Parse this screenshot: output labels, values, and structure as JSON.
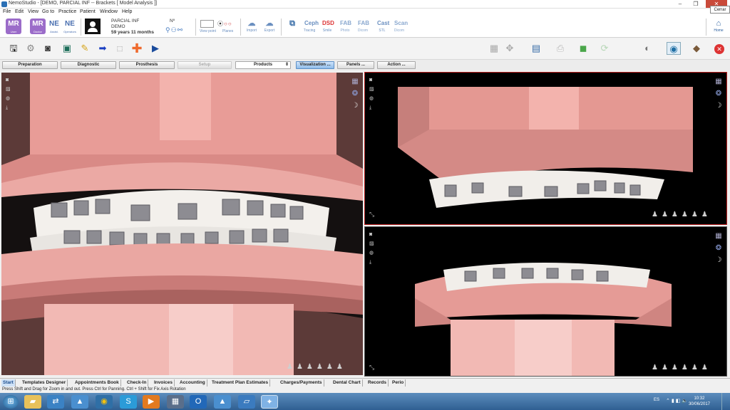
{
  "window": {
    "title": "NemoStudio - [DEMO, PARCIAL INF -- Brackets [ Model Analysis ]]",
    "close_tooltip": "Cerrar",
    "minimize_glyph": "‒",
    "restore_glyph": "❐",
    "close_glyph": "✕"
  },
  "menu": [
    "File",
    "Edit",
    "View",
    "Go to",
    "Practice",
    "Patient",
    "Window",
    "Help"
  ],
  "ribbon": {
    "modes": [
      {
        "label": "MR",
        "sub": "User"
      },
      {
        "label": "MR",
        "sub": "Doctor"
      },
      {
        "label": "NE",
        "sub": "Assist."
      },
      {
        "label": "NE",
        "sub": "Operators"
      }
    ],
    "patient": {
      "name": "PARCIAL INF",
      "group": "DEMO",
      "age": "59 years 11 months",
      "number_label": "Nº"
    },
    "view_point_label": "View point",
    "planes_label": "Planes",
    "tools": [
      {
        "label": "Import",
        "icon": "cloud-up-icon",
        "glyph": "☁"
      },
      {
        "label": "Export",
        "icon": "cloud-down-icon",
        "glyph": "☁"
      },
      {
        "label": "Ceph Tracing",
        "icon": "ceph-icon",
        "glyph": "Ceph"
      },
      {
        "label": "DSD Smile",
        "icon": "dsd-icon",
        "glyph": "DSD"
      },
      {
        "label": "FAB Photo",
        "icon": "fab-photo-icon",
        "glyph": "FAB"
      },
      {
        "label": "FAB Dicom",
        "icon": "fab-dicom-icon",
        "glyph": "FAB"
      },
      {
        "label": "Cast STL",
        "icon": "cast-icon",
        "glyph": "Cast"
      },
      {
        "label": "Scan Dicom",
        "icon": "scan-icon",
        "glyph": "Scan"
      }
    ],
    "home_label": "Home"
  },
  "tabs": [
    {
      "label": "Preparation",
      "state": "normal"
    },
    {
      "label": "Diagnostic",
      "state": "normal"
    },
    {
      "label": "Prosthesis",
      "state": "normal"
    },
    {
      "label": "Setup",
      "state": "disabled"
    },
    {
      "label": "Products",
      "state": "select"
    },
    {
      "label": "Visualization ...",
      "state": "active"
    },
    {
      "label": "Panels ...",
      "state": "normal"
    },
    {
      "label": "Action ...",
      "state": "normal"
    }
  ],
  "bottom_tabs": [
    "Start",
    "Templates Designer",
    "Appointments Book",
    "Check-In",
    "Invoices",
    "Accounting",
    "Treatment Plan Estimates",
    "Charges/Payments",
    "Dental Chart",
    "Records",
    "Perio"
  ],
  "status_text": "Press Shift and Drag for Zoom in and out. Press Ctrl for Panning. Ctrl + Shift for Fix Axis Rotation",
  "taskbar": {
    "language": "ES",
    "time": "10:32",
    "date": "30/06/2017"
  },
  "colors": {
    "accent": "#9b6cc9",
    "active_tab": "#8fbce9",
    "viewport_bg": "#000000",
    "gingiva": "#e8a09a",
    "base": "#f2b9b4"
  }
}
